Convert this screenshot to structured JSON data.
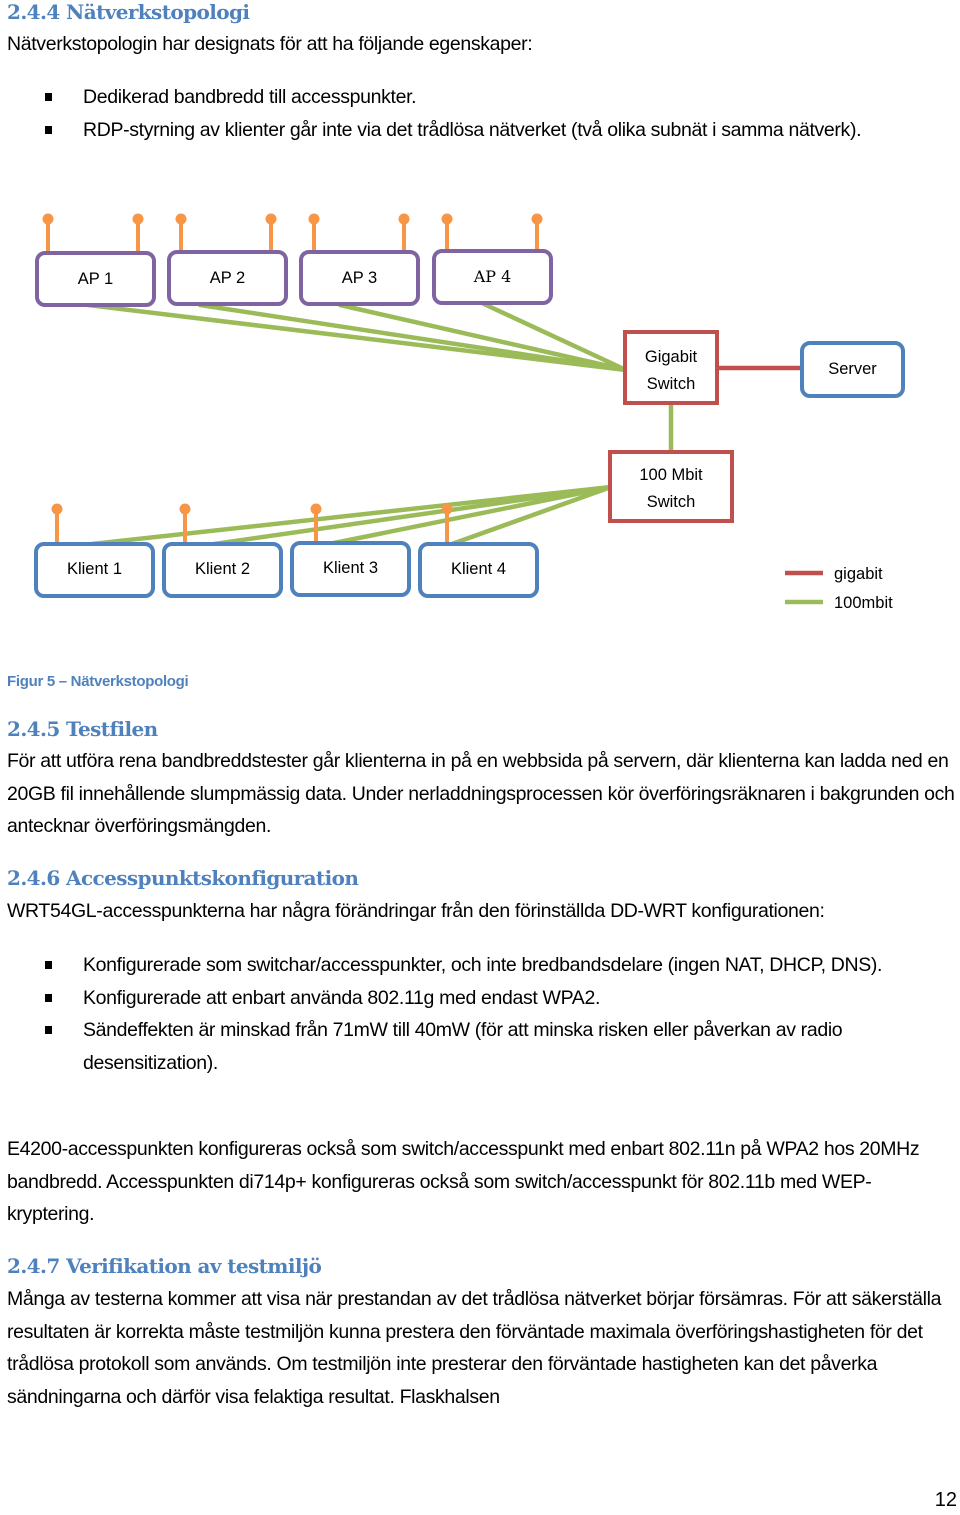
{
  "sections": [
    {
      "heading": "2.4.4 Nätverkstopologi",
      "intro": "Nätverkstopologin har designats för att ha följande egenskaper:",
      "bullets": [
        "Dedikerad bandbredd till accesspunkter.",
        "RDP-styrning av klienter går inte via det trådlösa nätverket (två olika subnät i samma nätverk)."
      ]
    },
    {
      "heading": "2.4.5 Testfilen",
      "body": "För att utföra rena bandbreddstester går klienterna in på en webbsida på servern, där klienterna kan ladda ned en 20GB fil innehållende slumpmässig data.  Under nerladdningsprocessen kör överföringsräknaren i bakgrunden och antecknar överföringsmängden."
    },
    {
      "heading": "2.4.6 Accesspunktskonfiguration",
      "intro": "WRT54GL-accesspunkterna har några förändringar från den förinställda DD-WRT konfigurationen:",
      "bullets": [
        "Konfigurerade som switchar/accesspunkter, och inte bredbandsdelare (ingen NAT, DHCP, DNS).",
        "Konfigurerade att enbart använda 802.11g med endast WPA2.",
        "Sändeffekten är minskad från 71mW till 40mW (för att minska risken eller påverkan av radio desensitization)."
      ],
      "body": "E4200-accesspunkten konfigureras också som switch/accesspunkt med enbart 802.11n på WPA2 hos 20MHz bandbredd. Accesspunkten di714p+ konfigureras också som switch/accesspunkt för 802.11b med WEP-kryptering."
    },
    {
      "heading": "2.4.7 Verifikation av testmiljö",
      "body": "Många av testerna kommer att visa när prestandan av det trådlösa nätverket börjar försämras. För att säkerställa resultaten är korrekta måste testmiljön kunna prestera den förväntade maximala överföringshastigheten för det trådlösa protokoll som används. Om testmiljön inte presterar den förväntade hastigheten kan det påverka sändningarna och därför visa felaktiga resultat. Flaskhalsen"
    }
  ],
  "diagram": {
    "access_points": [
      "AP 1",
      "AP 2",
      "AP 3",
      "AP 4"
    ],
    "gigabit_switch": [
      "Gigabit",
      "Switch"
    ],
    "server": "Server",
    "mbit_switch": [
      "100 Mbit",
      "Switch"
    ],
    "clients": [
      "Klient 1",
      "Klient 2",
      "Klient 3",
      "Klient 4"
    ],
    "legend": [
      {
        "label": "gigabit",
        "color": "#c0504d"
      },
      {
        "label": "100mbit",
        "color": "#9bbb59"
      }
    ],
    "colors": {
      "ap_border": "#8064a2",
      "client_border": "#4f81bd",
      "server_border": "#4f81bd",
      "switch_border": "#c0504d",
      "antenna": "#f79646",
      "link_100mbit": "#9bbb59",
      "link_gigabit": "#c0504d"
    }
  },
  "caption": "Figur 5 – Nätverkstopologi",
  "page_number": "12"
}
